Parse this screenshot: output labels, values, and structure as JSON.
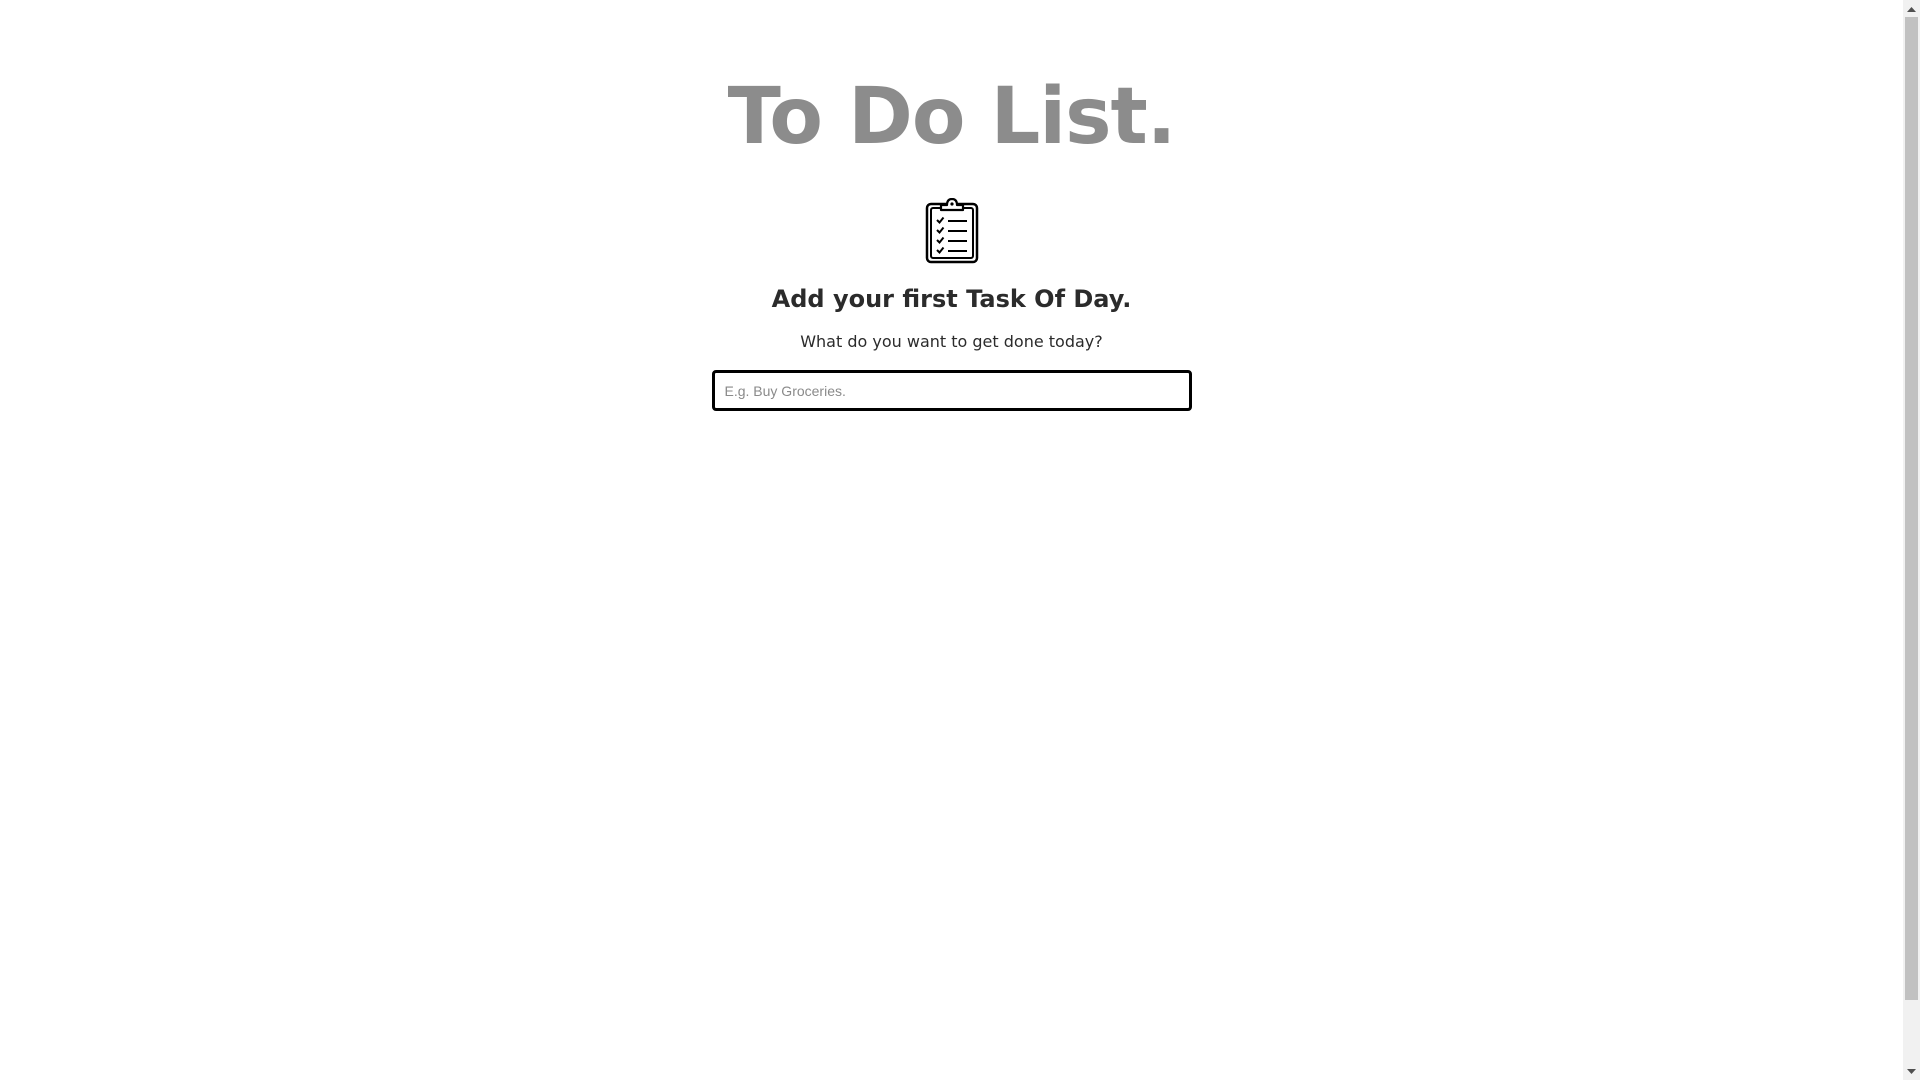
{
  "header": {
    "title": "To Do List."
  },
  "hero": {
    "icon": "clipboard-checklist-icon",
    "heading": "Add your first Task Of Day.",
    "subtitle": "What do you want to get done today?"
  },
  "task_input": {
    "value": "",
    "placeholder": "E.g. Buy Groceries."
  },
  "colors": {
    "title": "#8c8c8c",
    "text": "#2b2b2b",
    "input_border": "#000000",
    "background": "#ffffff"
  },
  "scrollbar": {
    "up_icon": "scroll-up-arrow-icon",
    "down_icon": "scroll-down-arrow-icon"
  }
}
